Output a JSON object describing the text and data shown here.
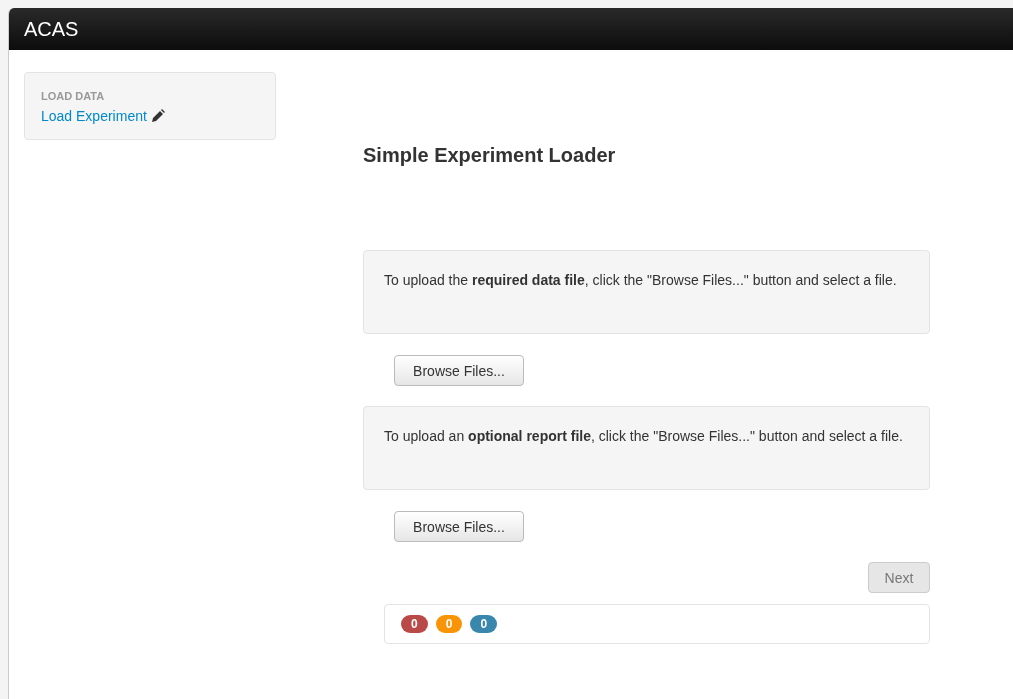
{
  "window": {
    "title": "ACAS"
  },
  "sidebar": {
    "heading": "LOAD DATA",
    "items": [
      {
        "label": "Load Experiment",
        "selected": false
      }
    ]
  },
  "main": {
    "title": "Simple Experiment Loader",
    "uploads": [
      {
        "instructions": "To upload the **required data file**, click the \"Browse Files...\" button and select a file.",
        "button": "Browse Files..."
      },
      {
        "instructions": "To upload an **optional report file**, click the \"Browse Files...\" button and select a file.",
        "button": "Browse Files..."
      }
    ],
    "next_button": {
      "label": "Next",
      "disabled": true
    },
    "counters": [
      {
        "count": "0",
        "color": "#b94a48"
      },
      {
        "count": "0",
        "color": "#f89406"
      },
      {
        "count": "0",
        "color": "#3a87ad"
      }
    ]
  }
}
